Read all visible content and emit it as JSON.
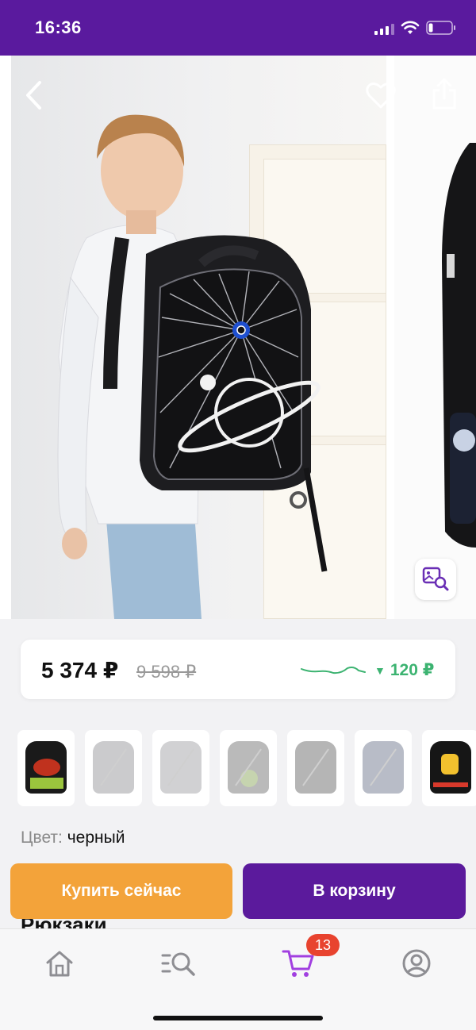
{
  "status_bar": {
    "time": "16:36"
  },
  "product": {
    "price_current": "5 374 ₽",
    "price_old": "9 598 ₽",
    "price_drop": "120 ₽",
    "color_label": "Цвет:",
    "color_value": "черный",
    "section_peek": "Рюкзаки"
  },
  "actions": {
    "buy_now": "Купить сейчас",
    "add_to_cart": "В корзину"
  },
  "tabbar": {
    "items": [
      "home-icon",
      "catalog-search-icon",
      "cart-icon",
      "profile-icon"
    ],
    "cart_badge": "13"
  },
  "thumbnails": [
    {
      "name": "dinosaurs",
      "available": true
    },
    {
      "name": "grey-red",
      "available": false
    },
    {
      "name": "grey",
      "available": false
    },
    {
      "name": "football-green",
      "available": false
    },
    {
      "name": "red-black",
      "available": false
    },
    {
      "name": "blue-space",
      "available": false
    },
    {
      "name": "peace-yellow",
      "available": true
    }
  ],
  "colors": {
    "brand_purple": "#5a1a9e",
    "buy_orange": "#f3a33a",
    "price_drop_green": "#3cb371",
    "badge_red": "#e8432f"
  }
}
